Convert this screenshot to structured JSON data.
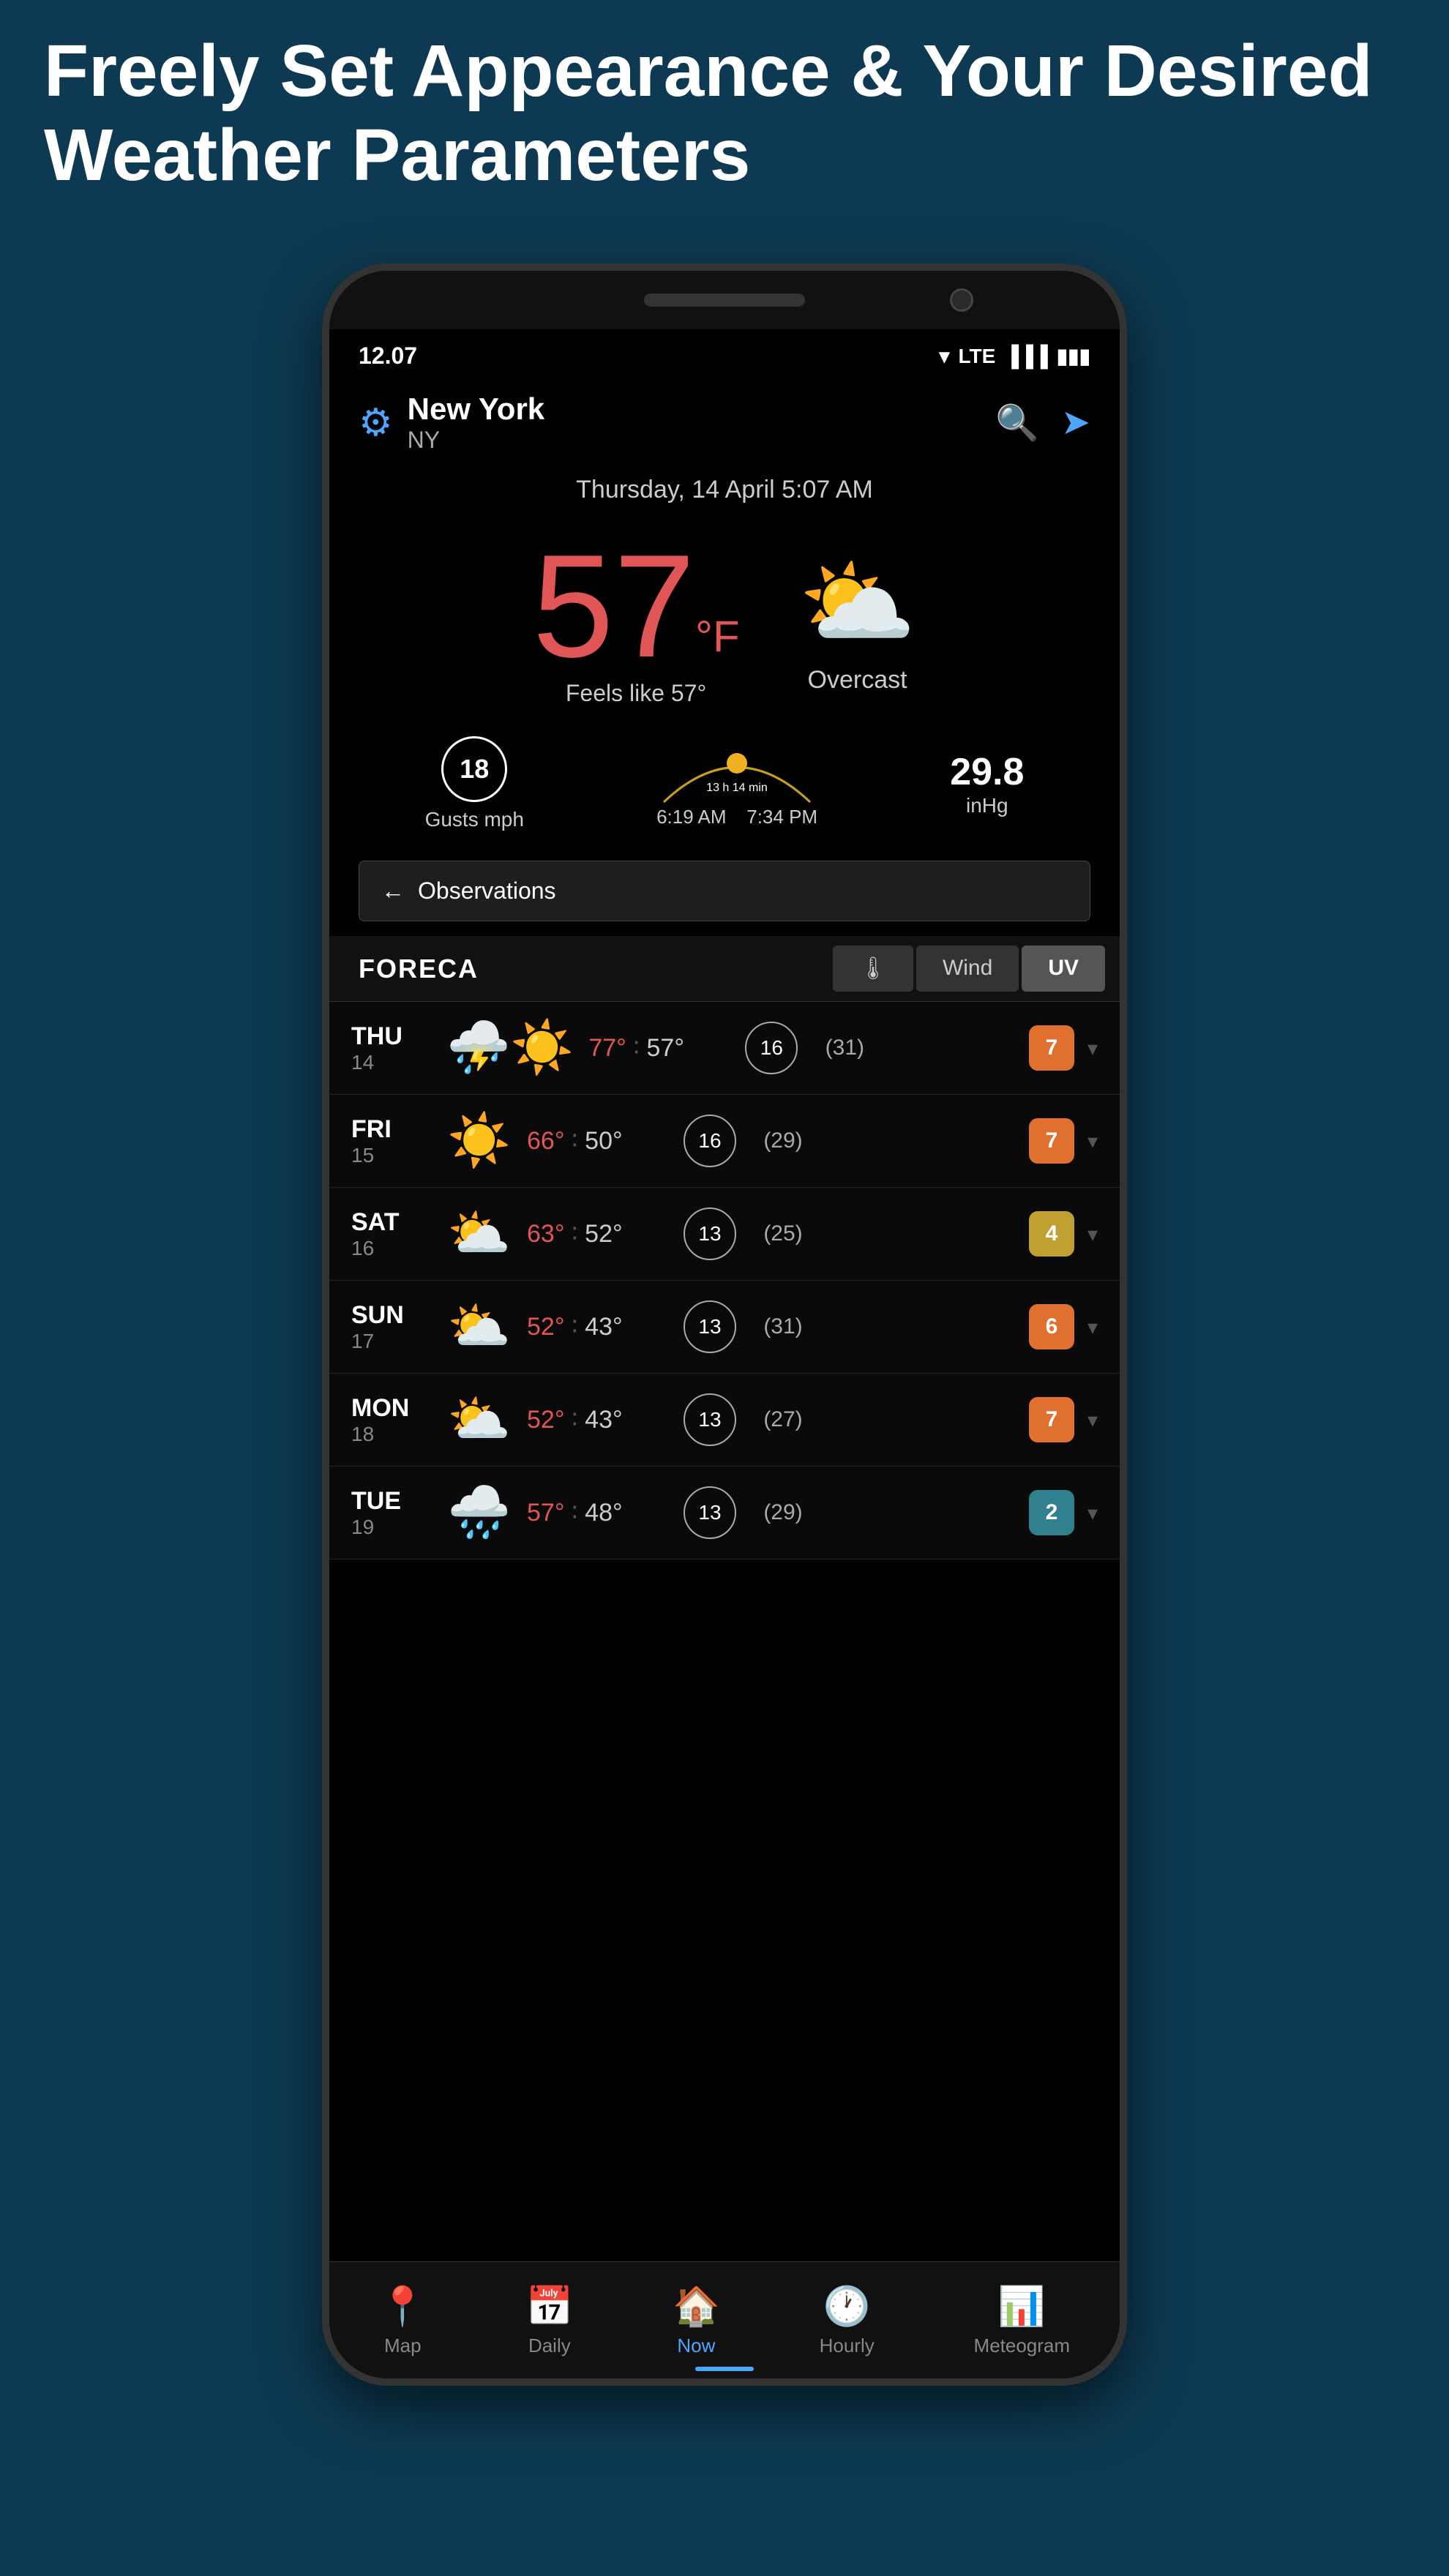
{
  "header": {
    "title": "Freely Set Appearance & Your Desired Weather Parameters"
  },
  "status_bar": {
    "time": "12.07",
    "lte": "LTE"
  },
  "location": {
    "city": "New York",
    "state": "NY",
    "date": "Thursday, 14 April 5:07 AM"
  },
  "weather": {
    "temperature": "57",
    "unit": "°F",
    "feels_like": "Feels like 57°",
    "description": "Overcast",
    "gusts": "18",
    "gusts_unit": "Gusts mph",
    "sun_duration": "13 h 14 min",
    "sunrise": "6:19 AM",
    "sunset": "7:34 PM",
    "pressure": "29.8",
    "pressure_unit": "inHg"
  },
  "observations_btn": {
    "label": "Observations"
  },
  "forecast_header": {
    "logo": "FORECA",
    "tabs": [
      {
        "label": "🌡",
        "active": true
      },
      {
        "label": "Wind",
        "active": false
      },
      {
        "label": "UV",
        "active": true
      }
    ]
  },
  "forecast": [
    {
      "day": "THU",
      "num": "14",
      "icon": "⛈️☀️",
      "high": "77°",
      "low": "57°",
      "wind": "16",
      "gust": "(31)",
      "uv": "7",
      "uv_color": "uv-orange"
    },
    {
      "day": "FRI",
      "num": "15",
      "icon": "☀️",
      "high": "66°",
      "low": "50°",
      "wind": "16",
      "gust": "(29)",
      "uv": "7",
      "uv_color": "uv-orange"
    },
    {
      "day": "SAT",
      "num": "16",
      "icon": "⛅",
      "high": "63°",
      "low": "52°",
      "wind": "13",
      "gust": "(25)",
      "uv": "4",
      "uv_color": "uv-yellow"
    },
    {
      "day": "SUN",
      "num": "17",
      "icon": "⛅",
      "high": "52°",
      "low": "43°",
      "wind": "13",
      "gust": "(31)",
      "uv": "6",
      "uv_color": "uv-orange"
    },
    {
      "day": "MON",
      "num": "18",
      "icon": "⛅",
      "high": "52°",
      "low": "43°",
      "wind": "13",
      "gust": "(27)",
      "uv": "7",
      "uv_color": "uv-orange"
    },
    {
      "day": "TUE",
      "num": "19",
      "icon": "🌧️",
      "high": "57°",
      "low": "48°",
      "wind": "13",
      "gust": "(29)",
      "uv": "2",
      "uv_color": "uv-teal"
    }
  ],
  "bottom_nav": [
    {
      "icon": "📍",
      "label": "Map",
      "active": false
    },
    {
      "icon": "📅",
      "label": "Daily",
      "active": false
    },
    {
      "icon": "🏠",
      "label": "Now",
      "active": true
    },
    {
      "icon": "🕐",
      "label": "Hourly",
      "active": false
    },
    {
      "icon": "📊",
      "label": "Meteogram",
      "active": false
    }
  ]
}
